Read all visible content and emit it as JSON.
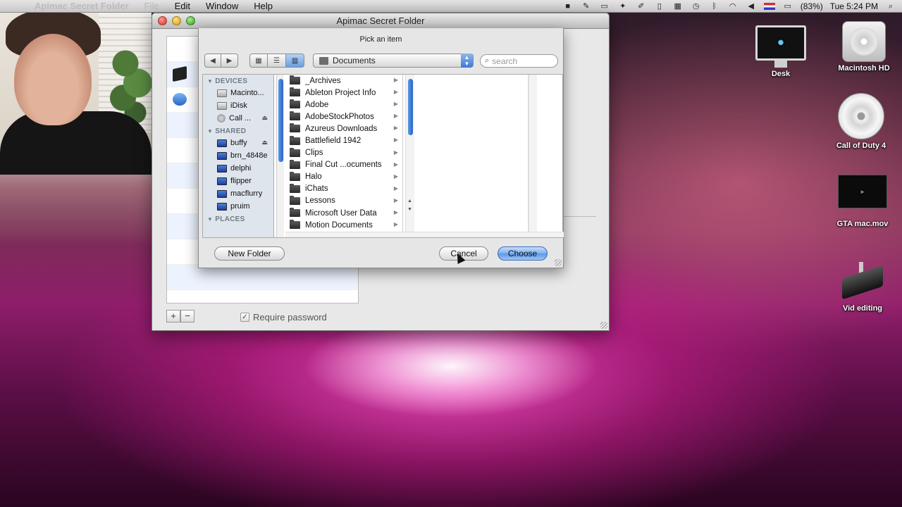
{
  "menubar": {
    "app_name": "Apimac Secret Folder",
    "items": [
      "File",
      "Edit",
      "Window",
      "Help"
    ],
    "battery": "(83%)",
    "clock": "Tue 5:24 PM"
  },
  "desktop": {
    "icons": [
      {
        "label": "Desk",
        "icon": "imac-icon"
      },
      {
        "label": "Macintosh HD",
        "icon": "hard-drive-icon"
      },
      {
        "label": "Call of Duty 4",
        "icon": "dvd-icon"
      },
      {
        "label": "GTA mac.mov",
        "icon": "movie-file-icon"
      },
      {
        "label": "Vid editing",
        "icon": "external-drive-icon"
      }
    ]
  },
  "secret_folder_window": {
    "title": "Apimac Secret Folder",
    "require_password_label": "Require password",
    "require_password_checked": true,
    "add_label": "+",
    "remove_label": "−"
  },
  "sheet": {
    "title": "Pick an item",
    "location": "Documents",
    "search_placeholder": "search",
    "sidebar": {
      "devices_header": "DEVICES",
      "devices": [
        "Macinto...",
        "iDisk",
        "Call ..."
      ],
      "shared_header": "SHARED",
      "shared": [
        "buffy",
        "brn_4848e",
        "delphi",
        "flipper",
        "macflurry",
        "pruim"
      ],
      "places_header": "PLACES"
    },
    "folders": [
      "_Archives",
      "Ableton Project Info",
      "Adobe",
      "AdobeStockPhotos",
      "Azureus Downloads",
      "Battlefield 1942",
      "Clips",
      "Final Cut ...ocuments",
      "Halo",
      "iChats",
      "Lessons",
      "Microsoft User Data",
      "Motion Documents"
    ],
    "new_folder_label": "New Folder",
    "cancel_label": "Cancel",
    "choose_label": "Choose"
  }
}
